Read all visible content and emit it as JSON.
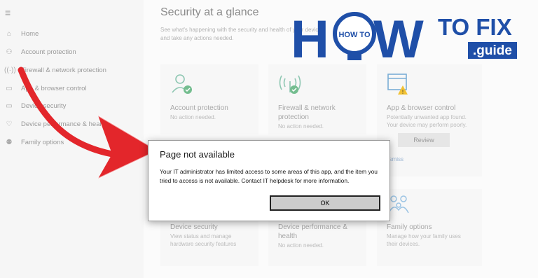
{
  "sidebar": {
    "menu_icon": "hamburger-menu-icon",
    "items": [
      {
        "label": "Home",
        "icon": "home-icon"
      },
      {
        "label": "Account protection",
        "icon": "person-icon"
      },
      {
        "label": "Firewall & network protection",
        "icon": "wifi-signal-icon"
      },
      {
        "label": "App & browser control",
        "icon": "browser-window-icon"
      },
      {
        "label": "Device security",
        "icon": "laptop-icon"
      },
      {
        "label": "Device performance & health",
        "icon": "heart-icon"
      },
      {
        "label": "Family options",
        "icon": "family-icon"
      }
    ]
  },
  "main": {
    "title": "Security at a glance",
    "subtitle": "See what's happening with the security and health of your device and take any actions needed.",
    "cards": [
      {
        "title": "Account protection",
        "status": "No action needed."
      },
      {
        "title": "Firewall & network protection",
        "status": "No action needed."
      },
      {
        "title": "App & browser control",
        "status": "Potentially unwanted app found. Your device may perform poorly.",
        "button": "Review",
        "link": "Dismiss"
      },
      {
        "title": "Device security",
        "status": "View status and manage hardware security features"
      },
      {
        "title": "Device performance & health",
        "status": "No action needed."
      },
      {
        "title": "Family options",
        "status": "Manage how your family uses their devices."
      }
    ]
  },
  "logo": {
    "part1": "H",
    "bulb": "HOW TO",
    "part2": "W",
    "part3": "TO FIX",
    "part4": ".guide"
  },
  "dialog": {
    "title": "Page not available",
    "body": "Your IT administrator has limited access to some areas of this app, and the item you tried to access is not available. Contact IT helpdesk for more information.",
    "ok_label": "OK"
  },
  "colors": {
    "logo_blue": "#1f4fa8",
    "arrow_red": "#e3262b",
    "accent": "#2f9f6c"
  }
}
